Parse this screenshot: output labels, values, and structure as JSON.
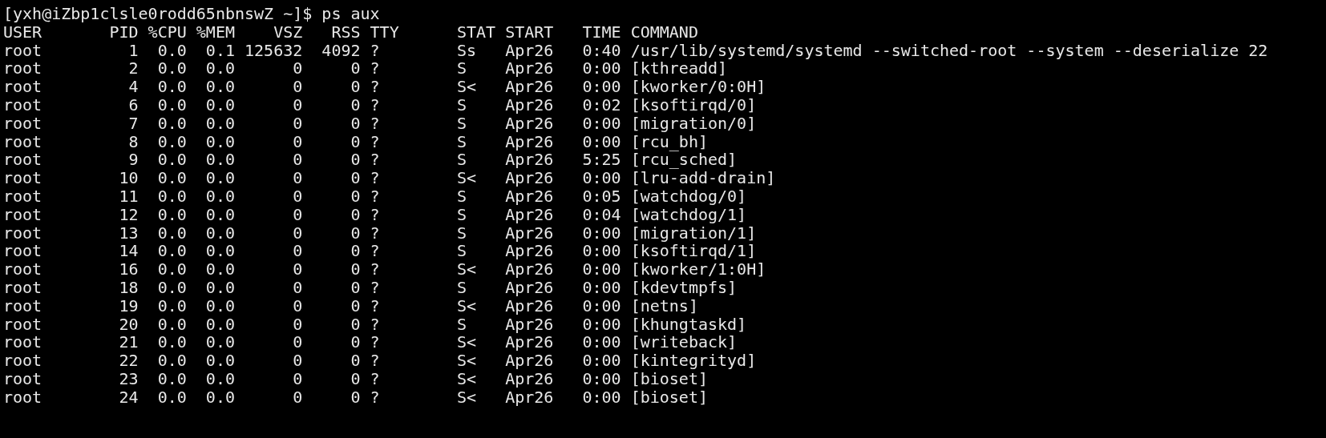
{
  "terminal": {
    "prompt": "[yxh@iZbp1clsle0rodd65nbnswZ ~]$ ps aux",
    "header": {
      "user": "USER",
      "pid": "PID",
      "cpu": "%CPU",
      "mem": "%MEM",
      "vsz": "VSZ",
      "rss": "RSS",
      "tty": "TTY",
      "stat": "STAT",
      "start": "START",
      "time": "TIME",
      "command": "COMMAND"
    },
    "rows": [
      {
        "user": "root",
        "pid": "1",
        "cpu": "0.0",
        "mem": "0.1",
        "vsz": "125632",
        "rss": "4092",
        "tty": "?",
        "stat": "Ss",
        "start": "Apr26",
        "time": "0:40",
        "command": "/usr/lib/systemd/systemd --switched-root --system --deserialize 22"
      },
      {
        "user": "root",
        "pid": "2",
        "cpu": "0.0",
        "mem": "0.0",
        "vsz": "0",
        "rss": "0",
        "tty": "?",
        "stat": "S",
        "start": "Apr26",
        "time": "0:00",
        "command": "[kthreadd]"
      },
      {
        "user": "root",
        "pid": "4",
        "cpu": "0.0",
        "mem": "0.0",
        "vsz": "0",
        "rss": "0",
        "tty": "?",
        "stat": "S<",
        "start": "Apr26",
        "time": "0:00",
        "command": "[kworker/0:0H]"
      },
      {
        "user": "root",
        "pid": "6",
        "cpu": "0.0",
        "mem": "0.0",
        "vsz": "0",
        "rss": "0",
        "tty": "?",
        "stat": "S",
        "start": "Apr26",
        "time": "0:02",
        "command": "[ksoftirqd/0]"
      },
      {
        "user": "root",
        "pid": "7",
        "cpu": "0.0",
        "mem": "0.0",
        "vsz": "0",
        "rss": "0",
        "tty": "?",
        "stat": "S",
        "start": "Apr26",
        "time": "0:00",
        "command": "[migration/0]"
      },
      {
        "user": "root",
        "pid": "8",
        "cpu": "0.0",
        "mem": "0.0",
        "vsz": "0",
        "rss": "0",
        "tty": "?",
        "stat": "S",
        "start": "Apr26",
        "time": "0:00",
        "command": "[rcu_bh]"
      },
      {
        "user": "root",
        "pid": "9",
        "cpu": "0.0",
        "mem": "0.0",
        "vsz": "0",
        "rss": "0",
        "tty": "?",
        "stat": "S",
        "start": "Apr26",
        "time": "5:25",
        "command": "[rcu_sched]"
      },
      {
        "user": "root",
        "pid": "10",
        "cpu": "0.0",
        "mem": "0.0",
        "vsz": "0",
        "rss": "0",
        "tty": "?",
        "stat": "S<",
        "start": "Apr26",
        "time": "0:00",
        "command": "[lru-add-drain]"
      },
      {
        "user": "root",
        "pid": "11",
        "cpu": "0.0",
        "mem": "0.0",
        "vsz": "0",
        "rss": "0",
        "tty": "?",
        "stat": "S",
        "start": "Apr26",
        "time": "0:05",
        "command": "[watchdog/0]"
      },
      {
        "user": "root",
        "pid": "12",
        "cpu": "0.0",
        "mem": "0.0",
        "vsz": "0",
        "rss": "0",
        "tty": "?",
        "stat": "S",
        "start": "Apr26",
        "time": "0:04",
        "command": "[watchdog/1]"
      },
      {
        "user": "root",
        "pid": "13",
        "cpu": "0.0",
        "mem": "0.0",
        "vsz": "0",
        "rss": "0",
        "tty": "?",
        "stat": "S",
        "start": "Apr26",
        "time": "0:00",
        "command": "[migration/1]"
      },
      {
        "user": "root",
        "pid": "14",
        "cpu": "0.0",
        "mem": "0.0",
        "vsz": "0",
        "rss": "0",
        "tty": "?",
        "stat": "S",
        "start": "Apr26",
        "time": "0:00",
        "command": "[ksoftirqd/1]"
      },
      {
        "user": "root",
        "pid": "16",
        "cpu": "0.0",
        "mem": "0.0",
        "vsz": "0",
        "rss": "0",
        "tty": "?",
        "stat": "S<",
        "start": "Apr26",
        "time": "0:00",
        "command": "[kworker/1:0H]"
      },
      {
        "user": "root",
        "pid": "18",
        "cpu": "0.0",
        "mem": "0.0",
        "vsz": "0",
        "rss": "0",
        "tty": "?",
        "stat": "S",
        "start": "Apr26",
        "time": "0:00",
        "command": "[kdevtmpfs]"
      },
      {
        "user": "root",
        "pid": "19",
        "cpu": "0.0",
        "mem": "0.0",
        "vsz": "0",
        "rss": "0",
        "tty": "?",
        "stat": "S<",
        "start": "Apr26",
        "time": "0:00",
        "command": "[netns]"
      },
      {
        "user": "root",
        "pid": "20",
        "cpu": "0.0",
        "mem": "0.0",
        "vsz": "0",
        "rss": "0",
        "tty": "?",
        "stat": "S",
        "start": "Apr26",
        "time": "0:00",
        "command": "[khungtaskd]"
      },
      {
        "user": "root",
        "pid": "21",
        "cpu": "0.0",
        "mem": "0.0",
        "vsz": "0",
        "rss": "0",
        "tty": "?",
        "stat": "S<",
        "start": "Apr26",
        "time": "0:00",
        "command": "[writeback]"
      },
      {
        "user": "root",
        "pid": "22",
        "cpu": "0.0",
        "mem": "0.0",
        "vsz": "0",
        "rss": "0",
        "tty": "?",
        "stat": "S<",
        "start": "Apr26",
        "time": "0:00",
        "command": "[kintegrityd]"
      },
      {
        "user": "root",
        "pid": "23",
        "cpu": "0.0",
        "mem": "0.0",
        "vsz": "0",
        "rss": "0",
        "tty": "?",
        "stat": "S<",
        "start": "Apr26",
        "time": "0:00",
        "command": "[bioset]"
      },
      {
        "user": "root",
        "pid": "24",
        "cpu": "0.0",
        "mem": "0.0",
        "vsz": "0",
        "rss": "0",
        "tty": "?",
        "stat": "S<",
        "start": "Apr26",
        "time": "0:00",
        "command": "[bioset]"
      }
    ]
  }
}
